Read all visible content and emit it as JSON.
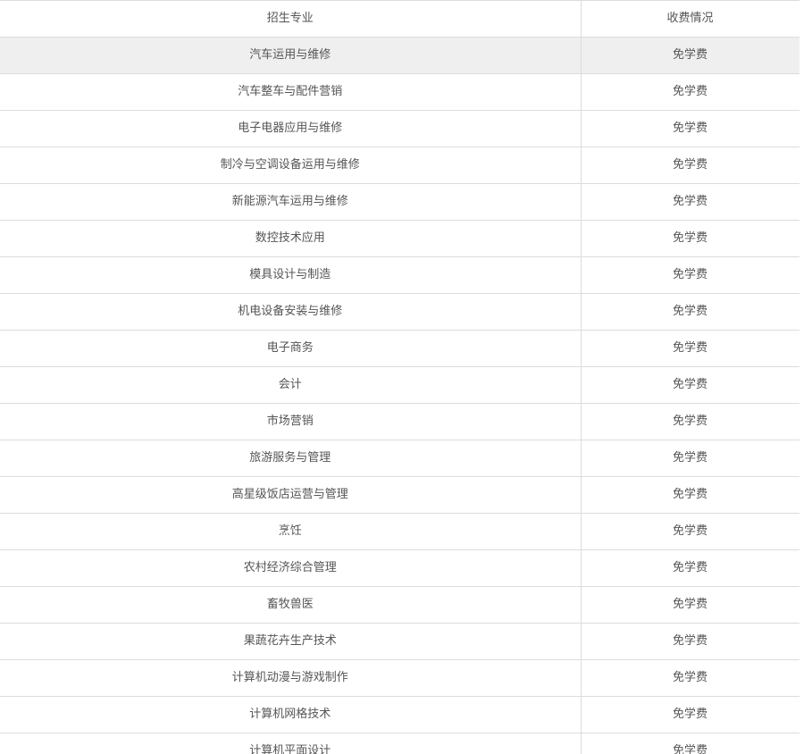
{
  "table": {
    "headers": [
      "招生专业",
      "收费情况"
    ],
    "highlighted_row": 0,
    "rows": [
      [
        "汽车运用与维修",
        "免学费"
      ],
      [
        "汽车整车与配件营销",
        "免学费"
      ],
      [
        "电子电器应用与维修",
        "免学费"
      ],
      [
        "制冷与空调设备运用与维修",
        "免学费"
      ],
      [
        "新能源汽车运用与维修",
        "免学费"
      ],
      [
        "数控技术应用",
        "免学费"
      ],
      [
        "模具设计与制造",
        "免学费"
      ],
      [
        "机电设备安装与维修",
        "免学费"
      ],
      [
        "电子商务",
        "免学费"
      ],
      [
        "会计",
        "免学费"
      ],
      [
        "市场营销",
        "免学费"
      ],
      [
        "旅游服务与管理",
        "免学费"
      ],
      [
        "高星级饭店运营与管理",
        "免学费"
      ],
      [
        "烹饪",
        "免学费"
      ],
      [
        "农村经济综合管理",
        "免学费"
      ],
      [
        "畜牧兽医",
        "免学费"
      ],
      [
        "果蔬花卉生产技术",
        "免学费"
      ],
      [
        "计算机动漫与游戏制作",
        "免学费"
      ],
      [
        "计算机网格技术",
        "免学费"
      ],
      [
        "计算机平面设计",
        "免学费"
      ]
    ]
  }
}
